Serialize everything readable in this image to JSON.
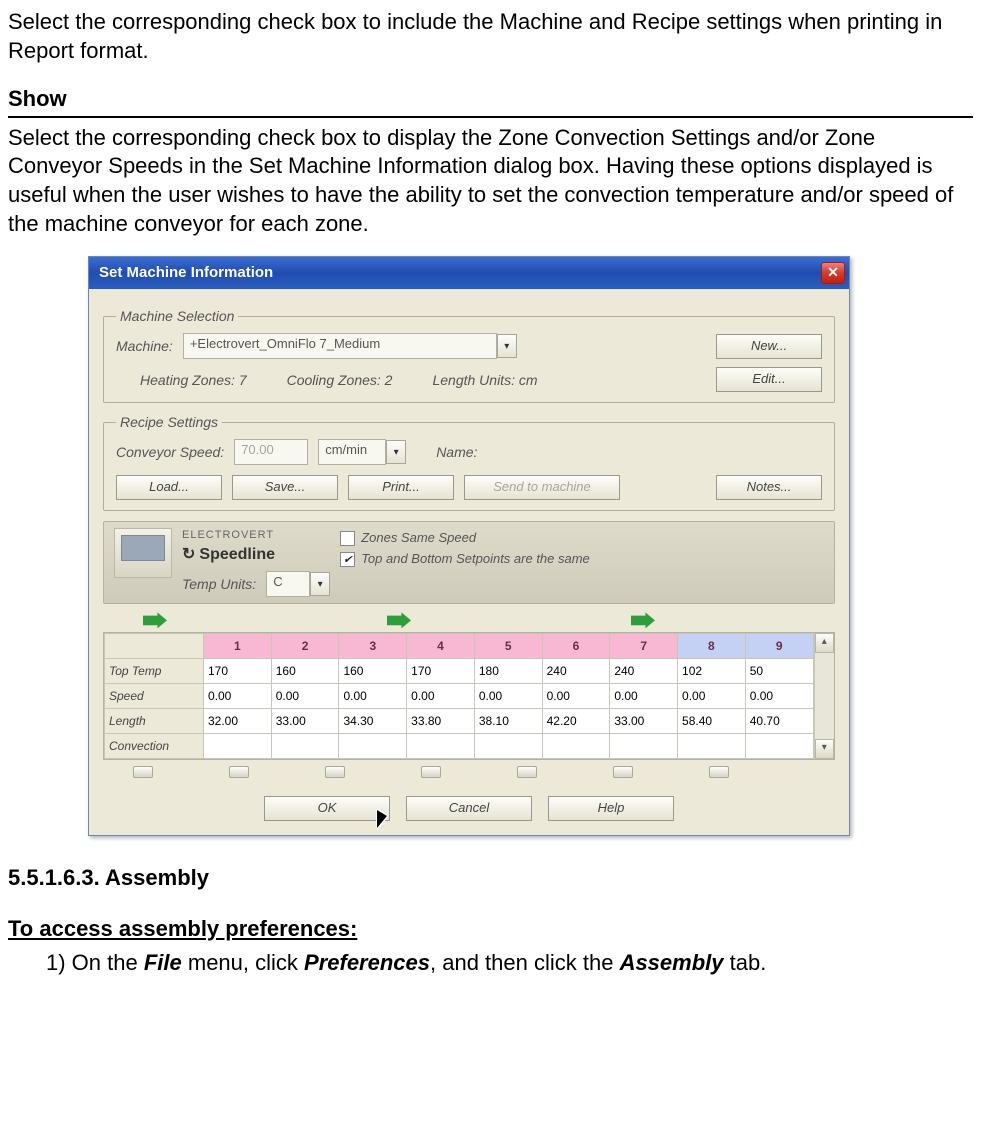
{
  "intro_para": "Select the corresponding check box to include the Machine and Recipe settings when printing in Report format.",
  "section_show": "Show",
  "show_para": "Select the corresponding check box to display the Zone Convection Settings and/or Zone Conveyor Speeds in the Set Machine Information dialog box. Having these options displayed is useful when the user wishes to have the ability to set the convection temperature and/or speed of the machine conveyor for each zone.",
  "dialog": {
    "title": "Set Machine Information",
    "close": "✕",
    "group_machine": {
      "legend": "Machine Selection",
      "label_machine": "Machine:",
      "machine_value": "+Electrovert_OmniFlo 7_Medium",
      "btn_new": "New...",
      "label_heating": "Heating Zones: 7",
      "label_cooling": "Cooling Zones: 2",
      "label_units": "Length Units: cm",
      "btn_edit": "Edit..."
    },
    "group_recipe": {
      "legend": "Recipe Settings",
      "label_speed": "Conveyor Speed:",
      "speed_value": "70.00",
      "speed_unit": "cm/min",
      "label_name": "Name:",
      "btn_load": "Load...",
      "btn_save": "Save...",
      "btn_print": "Print...",
      "btn_send": "Send to machine",
      "btn_notes": "Notes..."
    },
    "panel": {
      "brand_top": "ELECTROVERT",
      "brand_main": "Speedline",
      "label_tempunits": "Temp Units:",
      "tempunits_value": "C",
      "chk_samespeed": "Zones Same Speed",
      "chk_samesetpoints": "Top and Bottom Setpoints are the same"
    },
    "table": {
      "cols": [
        "1",
        "2",
        "3",
        "4",
        "5",
        "6",
        "7",
        "8",
        "9"
      ],
      "rows": [
        {
          "head": "Top Temp",
          "vals": [
            "170",
            "160",
            "160",
            "170",
            "180",
            "240",
            "240",
            "102",
            "50"
          ]
        },
        {
          "head": "Speed",
          "vals": [
            "0.00",
            "0.00",
            "0.00",
            "0.00",
            "0.00",
            "0.00",
            "0.00",
            "0.00",
            "0.00"
          ]
        },
        {
          "head": "Length",
          "vals": [
            "32.00",
            "33.00",
            "34.30",
            "33.80",
            "38.10",
            "42.20",
            "33.00",
            "58.40",
            "40.70"
          ]
        },
        {
          "head": "Convection",
          "vals": [
            "",
            "",
            "",
            "",
            "",
            "",
            "",
            "",
            ""
          ]
        }
      ]
    },
    "buttons": {
      "ok": "OK",
      "cancel": "Cancel",
      "help": "Help"
    }
  },
  "heading_assembly_num": "5.5.1.6.3.",
  "heading_assembly_txt": "Assembly",
  "subhead_access": "To access assembly preferences:",
  "step1_pre": "1) On the ",
  "step1_b1": "File",
  "step1_mid1": " menu, click ",
  "step1_b2": "Preferences",
  "step1_mid2": ", and then click the ",
  "step1_b3": "Assembly",
  "step1_post": " tab."
}
